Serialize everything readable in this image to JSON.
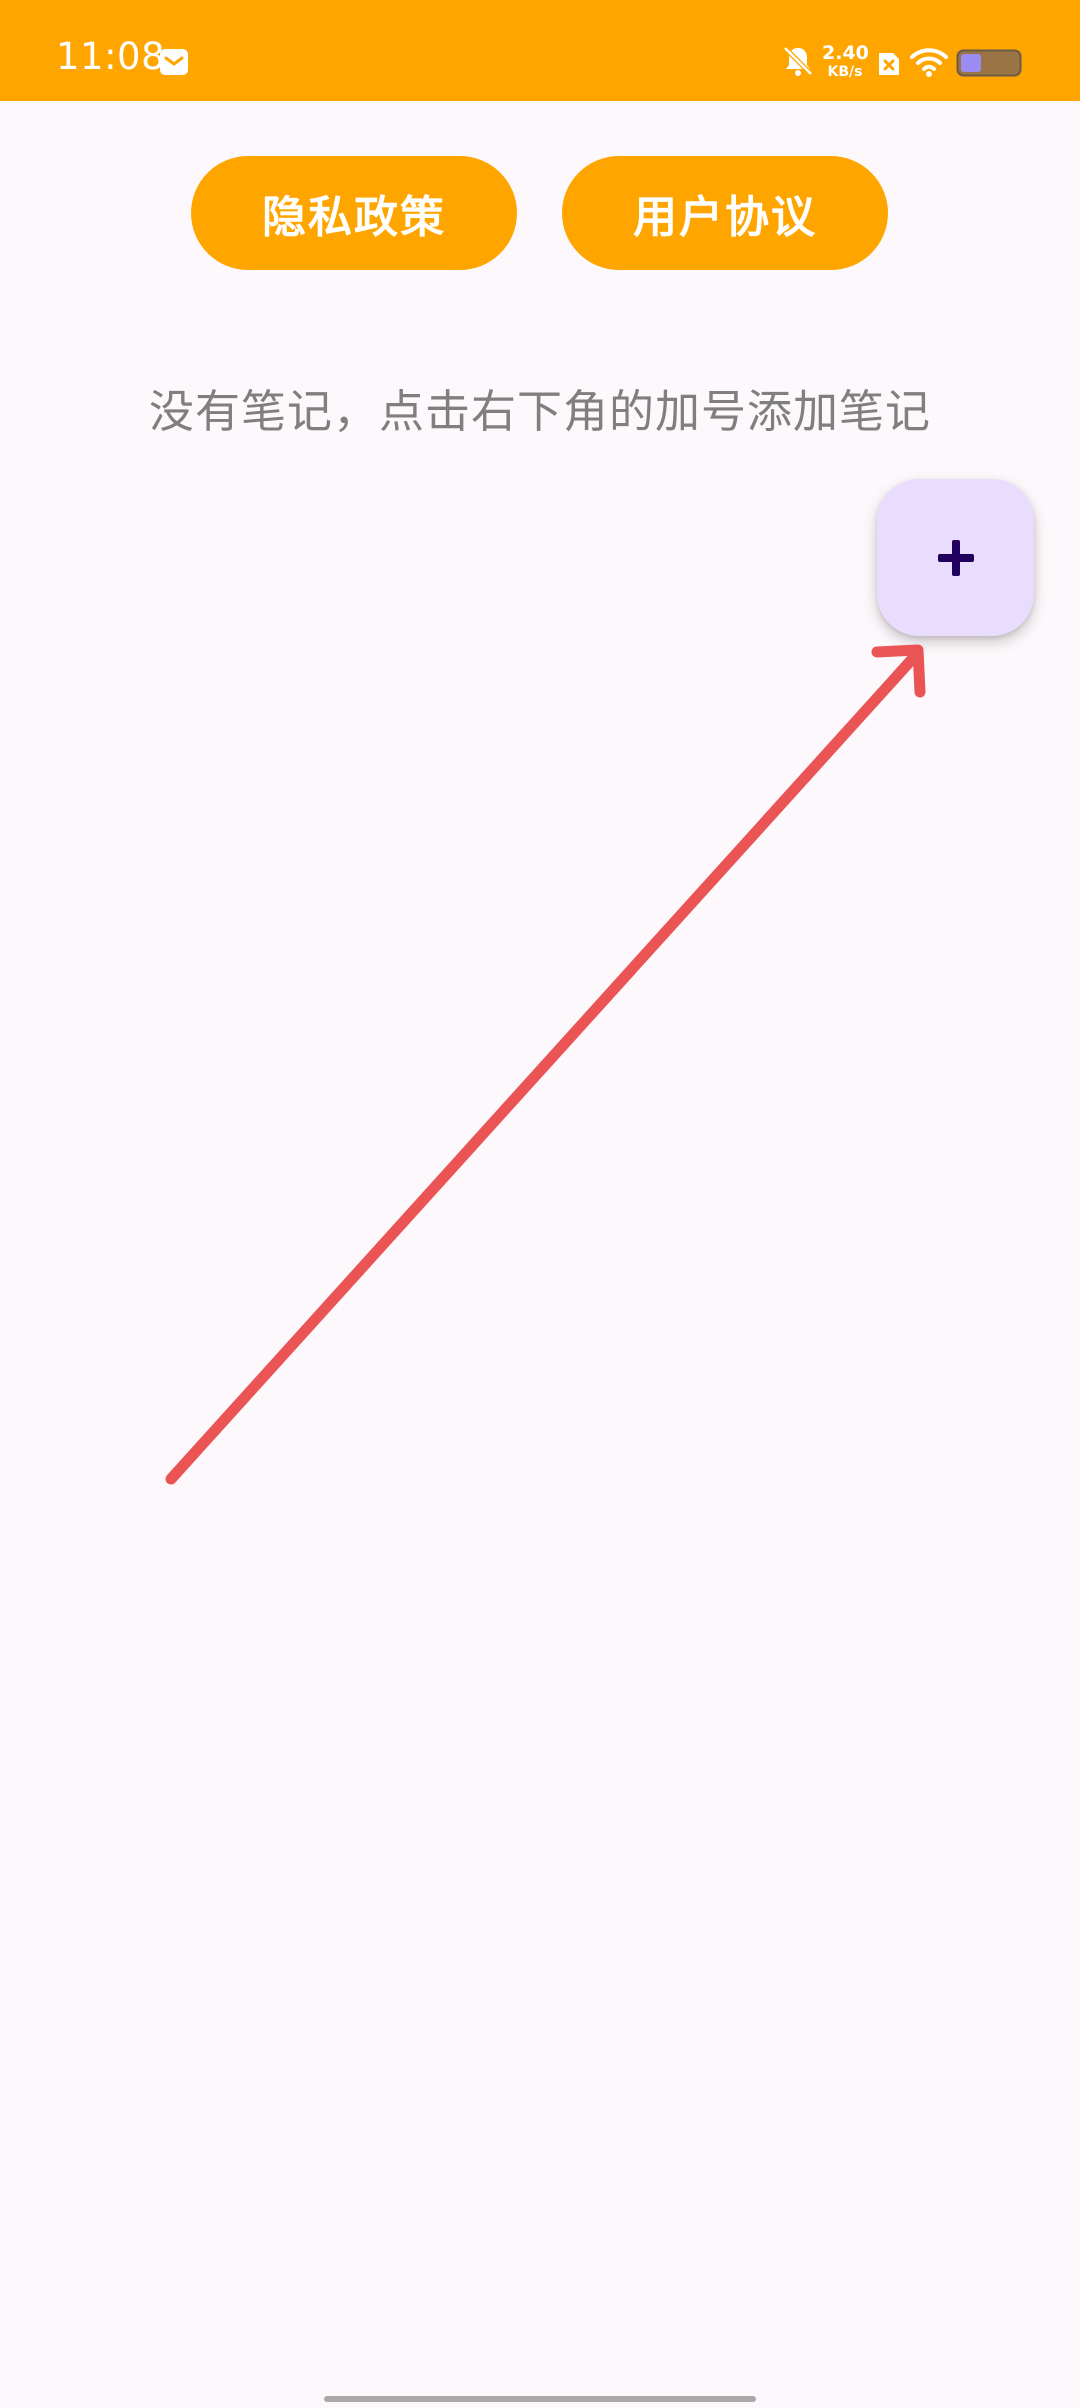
{
  "status_bar": {
    "time": "11:08",
    "network_speed_value": "2.40",
    "network_speed_unit": "KB/s",
    "background_color": "#ffa500",
    "icons": [
      "mail-icon",
      "bell-off-icon",
      "sim-disabled-icon",
      "wifi-icon",
      "battery-icon"
    ]
  },
  "header_buttons": {
    "privacy_policy": "隐私政策",
    "user_agreement": "用户协议",
    "color": "#ffa500"
  },
  "empty_state": {
    "message": "没有笔记，点击右下角的加号添加笔记"
  },
  "fab": {
    "icon": "plus-icon",
    "background_color": "#e9ddfe",
    "icon_color": "#21005d"
  },
  "annotation": {
    "icon": "arrow-icon",
    "color": "#ea5455"
  }
}
